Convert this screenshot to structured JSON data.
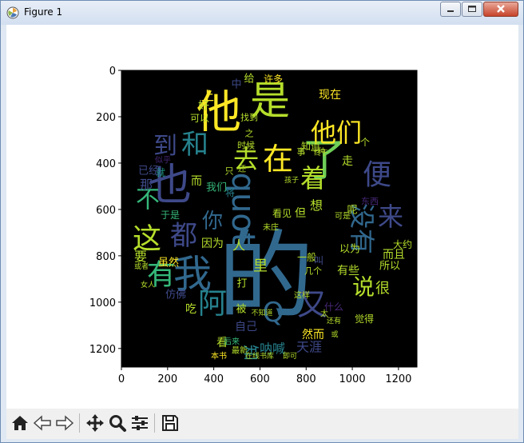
{
  "window": {
    "title": "Figure 1",
    "app_icon": "matplotlib-figure-icon"
  },
  "title_buttons": [
    {
      "name": "minimize-button",
      "icon": "minimize-icon"
    },
    {
      "name": "maximize-button",
      "icon": "maximize-icon"
    },
    {
      "name": "close-button",
      "icon": "close-icon"
    }
  ],
  "plot": {
    "x_ticks": [
      "0",
      "200",
      "400",
      "600",
      "800",
      "1000",
      "1200"
    ],
    "y_ticks": [
      "0",
      "200",
      "400",
      "600",
      "800",
      "1000",
      "1200"
    ],
    "image_background": "#000000",
    "colormap": "viridis"
  },
  "wordcloud": [
    {
      "text": "的",
      "color": "#31688e"
    },
    {
      "text": "他",
      "color": "#fde725"
    },
    {
      "text": "是",
      "color": "#b5de2b"
    },
    {
      "text": "了",
      "color": "#6ece58"
    },
    {
      "text": "也",
      "color": "#3e4989"
    },
    {
      "text": "我",
      "color": "#31688e"
    },
    {
      "text": "quot",
      "color": "#31688e"
    },
    {
      "text": "有",
      "color": "#35b779"
    },
    {
      "text": "在",
      "color": "#fde725"
    },
    {
      "text": "他们",
      "color": "#fde725"
    },
    {
      "text": "便",
      "color": "#3e4989"
    },
    {
      "text": "和",
      "color": "#26828e"
    },
    {
      "text": "去",
      "color": "#b5de2b"
    },
    {
      "text": "着",
      "color": "#b5de2b"
    },
    {
      "text": "到",
      "color": "#3e4989"
    },
    {
      "text": "这",
      "color": "#b5de2b"
    },
    {
      "text": "都",
      "color": "#3e4989"
    },
    {
      "text": "不",
      "color": "#35b779"
    },
    {
      "text": "来",
      "color": "#3e4989"
    },
    {
      "text": "没有",
      "color": "#31688e"
    },
    {
      "text": "阿",
      "color": "#26828e"
    },
    {
      "text": "Q",
      "color": "#31688e"
    },
    {
      "text": "又",
      "color": "#3e4989"
    },
    {
      "text": "说",
      "color": "#b5de2b"
    },
    {
      "text": "你",
      "color": "#31688e"
    },
    {
      "text": "就",
      "color": "#1f9e89"
    },
    {
      "text": "要",
      "color": "#b5de2b"
    },
    {
      "text": "那",
      "color": "#3e4989"
    },
    {
      "text": "而",
      "color": "#b5de2b"
    },
    {
      "text": "很",
      "color": "#b5de2b"
    },
    {
      "text": "吃",
      "color": "#b5de2b"
    },
    {
      "text": "看",
      "color": "#b5de2b"
    },
    {
      "text": "知",
      "color": "#26828e"
    },
    {
      "text": "想",
      "color": "#b5de2b"
    },
    {
      "text": "但",
      "color": "#b5de2b"
    },
    {
      "text": "人",
      "color": "#b5de2b"
    },
    {
      "text": "里",
      "color": "#b5de2b"
    },
    {
      "text": "因为",
      "color": "#b5de2b"
    },
    {
      "text": "然而",
      "color": "#fde725"
    },
    {
      "text": "呐喊",
      "color": "#26828e"
    },
    {
      "text": "天涯",
      "color": "#3e4989"
    },
    {
      "text": "自己",
      "color": "#3e4989"
    },
    {
      "text": "仿佛",
      "color": "#3e4989"
    },
    {
      "text": "虽然",
      "color": "#fde725"
    },
    {
      "text": "于是",
      "color": "#35b779"
    },
    {
      "text": "我们",
      "color": "#35b779"
    },
    {
      "text": "已经",
      "color": "#3e4989"
    },
    {
      "text": "可以",
      "color": "#b5de2b"
    },
    {
      "text": "现在",
      "color": "#fde725"
    },
    {
      "text": "许多",
      "color": "#fde725"
    },
    {
      "text": "什么",
      "color": "#482878"
    },
    {
      "text": "所以",
      "color": "#b5de2b"
    },
    {
      "text": "有些",
      "color": "#b5de2b"
    },
    {
      "text": "而且",
      "color": "#b5de2b"
    },
    {
      "text": "看见",
      "color": "#b5de2b"
    },
    {
      "text": "觉得",
      "color": "#b5de2b"
    },
    {
      "text": "以为",
      "color": "#b5de2b"
    },
    {
      "text": "一般",
      "color": "#b5de2b"
    },
    {
      "text": "时候",
      "color": "#b5de2b"
    },
    {
      "text": "知道",
      "color": "#b5de2b"
    },
    {
      "text": "给",
      "color": "#b5de2b"
    },
    {
      "text": "中",
      "color": "#3e4989"
    },
    {
      "text": "上",
      "color": "#fde725"
    },
    {
      "text": "好",
      "color": "#b5de2b"
    },
    {
      "text": "走",
      "color": "#b5de2b"
    },
    {
      "text": "呢",
      "color": "#b5de2b"
    },
    {
      "text": "被",
      "color": "#b5de2b"
    },
    {
      "text": "打",
      "color": "#b5de2b"
    },
    {
      "text": "叫",
      "color": "#3e4989"
    },
    {
      "text": "将",
      "color": "#26828e"
    },
    {
      "text": "只",
      "color": "#b5de2b"
    },
    {
      "text": "本书",
      "color": "#fde725"
    },
    {
      "text": "最新",
      "color": "#b5de2b"
    },
    {
      "text": "在线书库",
      "color": "#b5de2b"
    },
    {
      "text": "即可",
      "color": "#b5de2b"
    },
    {
      "text": "后来",
      "color": "#35b779"
    },
    {
      "text": "东西",
      "color": "#482878"
    },
    {
      "text": "几个",
      "color": "#b5de2b"
    },
    {
      "text": "还有",
      "color": "#b5de2b"
    },
    {
      "text": "或者",
      "color": "#b5de2b"
    },
    {
      "text": "女人",
      "color": "#b5de2b"
    },
    {
      "text": "未庄",
      "color": "#b5de2b"
    },
    {
      "text": "一种",
      "color": "#b5de2b"
    },
    {
      "text": "孩子",
      "color": "#b5de2b"
    },
    {
      "text": "大约",
      "color": "#b5de2b"
    },
    {
      "text": "或",
      "color": "#b5de2b"
    },
    {
      "text": "终于",
      "color": "#b5de2b"
    },
    {
      "text": "可是",
      "color": "#b5de2b"
    },
    {
      "text": "太",
      "color": "#b5de2b"
    },
    {
      "text": "还",
      "color": "#b5de2b"
    },
    {
      "text": "事",
      "color": "#b5de2b"
    },
    {
      "text": "不知道",
      "color": "#b5de2b"
    },
    {
      "text": "这样",
      "color": "#b5de2b"
    },
    {
      "text": "之",
      "color": "#b5de2b"
    },
    {
      "text": "似乎",
      "color": "#482878"
    },
    {
      "text": "找到",
      "color": "#b5de2b"
    },
    {
      "text": "个",
      "color": "#b5de2b"
    },
    {
      "text": "下",
      "color": "#35b779"
    }
  ],
  "toolbar": [
    {
      "name": "home-button",
      "icon": "home-icon"
    },
    {
      "name": "back-button",
      "icon": "back-arrow-icon"
    },
    {
      "name": "forward-button",
      "icon": "forward-arrow-icon"
    },
    {
      "name": "pan-button",
      "icon": "move-icon"
    },
    {
      "name": "zoom-button",
      "icon": "magnifier-icon"
    },
    {
      "name": "configure-subplots-button",
      "icon": "sliders-icon"
    },
    {
      "name": "save-button",
      "icon": "floppy-disk-icon"
    }
  ]
}
